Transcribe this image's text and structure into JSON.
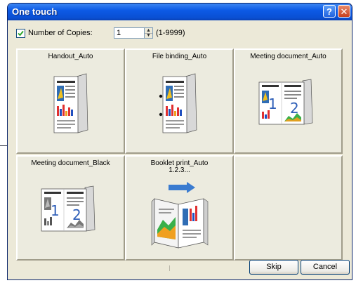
{
  "window": {
    "title": "One touch",
    "help_label": "?",
    "close_label": "✕"
  },
  "copies": {
    "checked": true,
    "label": "Number of Copies:",
    "value": "1",
    "range": "(1-9999)"
  },
  "presets": [
    {
      "label": "Handout_Auto",
      "icon": "handout-document-icon"
    },
    {
      "label": "File binding_Auto",
      "icon": "file-binding-document-icon"
    },
    {
      "label": "Meeting document_Auto",
      "icon": "meeting-document-color-icon"
    },
    {
      "label": "Meeting document_Black",
      "icon": "meeting-document-black-icon"
    },
    {
      "label": "Booklet print_Auto",
      "icon": "booklet-icon",
      "overlay": "1.2.3..."
    },
    {
      "label": "",
      "icon": ""
    }
  ],
  "buttons": {
    "skip": "Skip",
    "cancel": "Cancel"
  },
  "colors": {
    "titlebar": "#0a4fd2",
    "dialog_bg": "#ece9d8",
    "arrow_blue": "#3a7bd0"
  }
}
